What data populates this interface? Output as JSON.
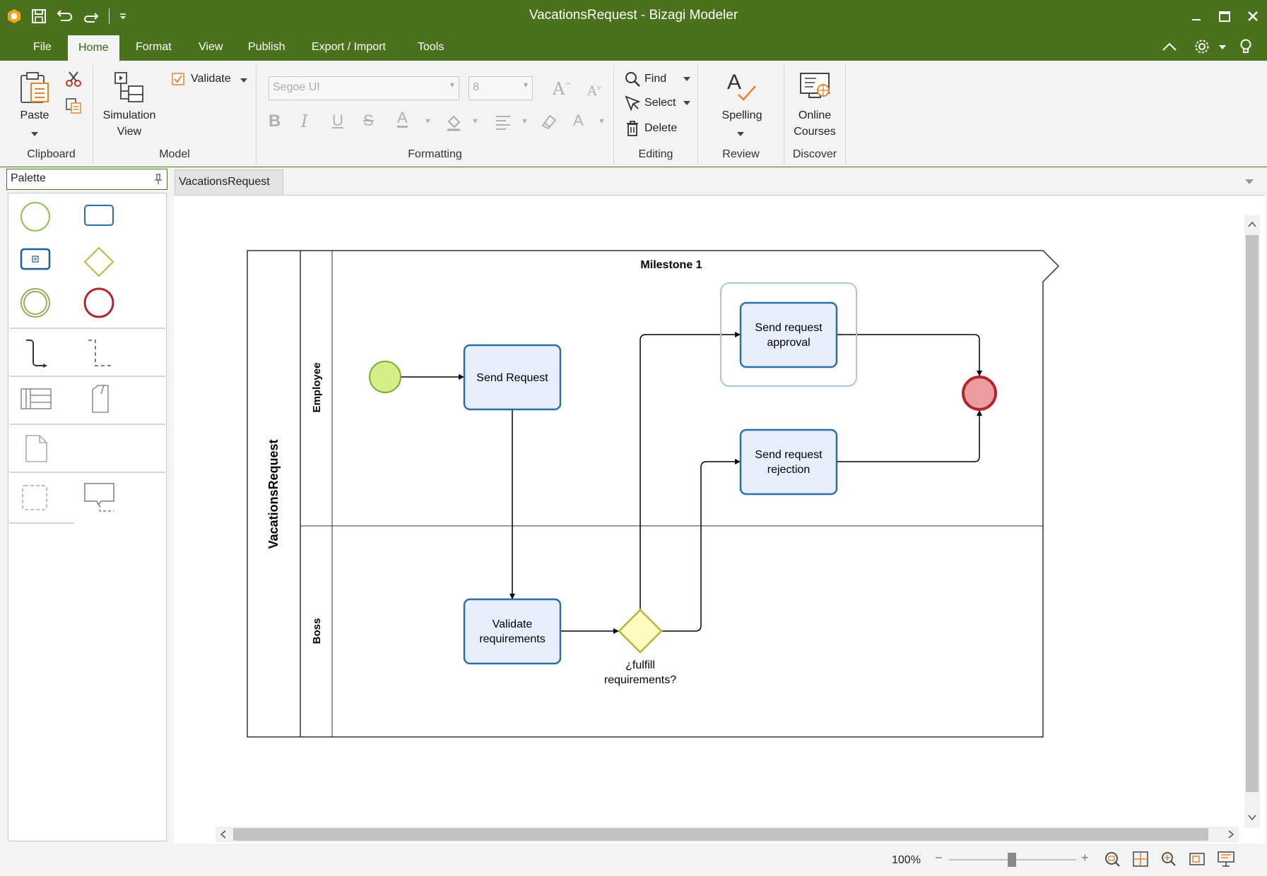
{
  "window": {
    "title": "VacationsRequest - Bizagi Modeler",
    "controls": [
      "minimize-icon",
      "maximize-icon",
      "close-icon"
    ]
  },
  "quick_access": [
    "app-logo-icon",
    "save-icon",
    "undo-icon",
    "redo-icon",
    "customize-qat-icon"
  ],
  "menu": {
    "items": [
      "File",
      "Home",
      "Format",
      "View",
      "Publish",
      "Export / Import",
      "Tools"
    ],
    "active": "Home"
  },
  "ribbon": {
    "clipboard": {
      "label": "Clipboard",
      "paste": "Paste"
    },
    "model": {
      "label": "Model",
      "simulation_line1": "Simulation",
      "simulation_line2": "View",
      "validate": "Validate"
    },
    "formatting": {
      "label": "Formatting",
      "font": "Segoe UI",
      "size": "8"
    },
    "editing": {
      "label": "Editing",
      "find": "Find",
      "select": "Select",
      "delete": "Delete"
    },
    "review": {
      "label": "Review",
      "spelling": "Spelling"
    },
    "discover": {
      "label": "Discover",
      "online_line1": "Online",
      "online_line2": "Courses"
    }
  },
  "palette": {
    "title": "Palette"
  },
  "document": {
    "tab": "VacationsRequest"
  },
  "diagram": {
    "pool": "VacationsRequest",
    "milestone": "Milestone 1",
    "lanes": [
      "Employee",
      "Boss"
    ],
    "tasks": {
      "send_request": "Send Request",
      "approval": [
        "Send request",
        "approval"
      ],
      "rejection": [
        "Send request",
        "rejection"
      ],
      "validate": [
        "Validate",
        "requirements"
      ]
    },
    "gateway": [
      "¿fulfill",
      "requirements?"
    ],
    "colors": {
      "start_fill": "#d4ee8a",
      "start_stroke": "#86a82e",
      "task_fill": "#e8eefc",
      "task_stroke": "#2a6fa8",
      "gateway_fill": "#fdfcc0",
      "gateway_stroke": "#b5b43a",
      "end_fill": "#eb9c9f",
      "end_stroke": "#b3252b"
    }
  },
  "status": {
    "zoom": "100%"
  }
}
